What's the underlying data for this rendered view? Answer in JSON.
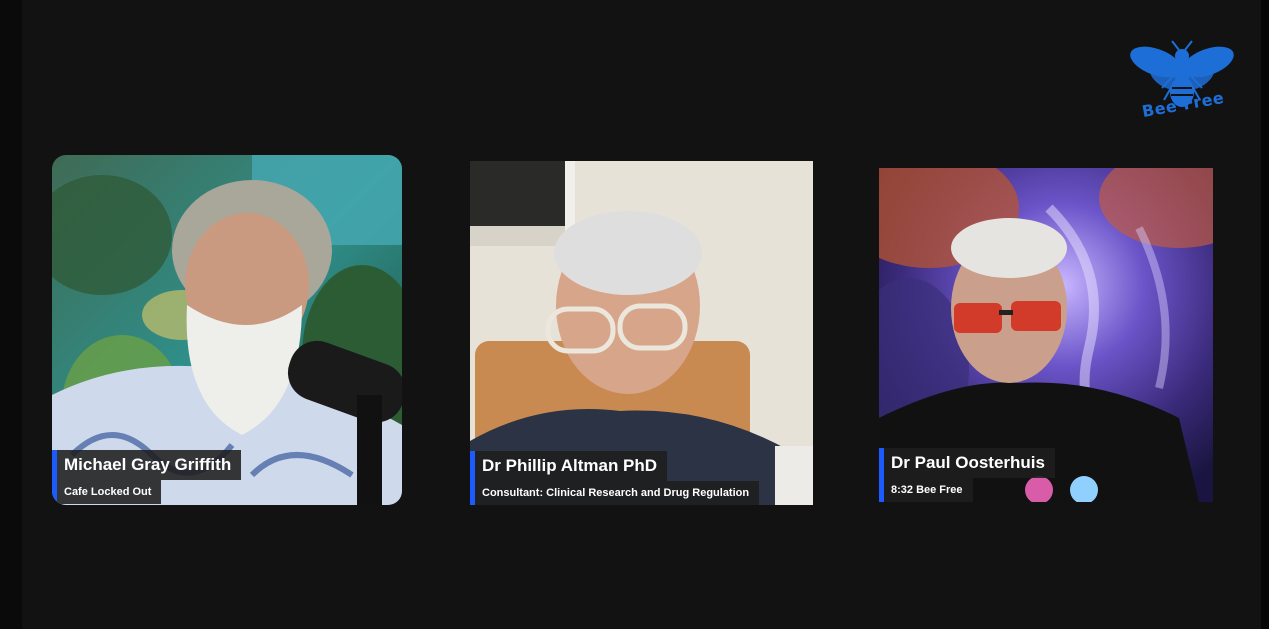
{
  "branding": {
    "logo_icon": "bee-icon",
    "logo_text": "Bee Free",
    "logo_color": "#1e6ed8"
  },
  "accent_color": "#1e5bff",
  "participants": [
    {
      "name": "Michael Gray Griffith",
      "subtitle": "Cafe Locked Out"
    },
    {
      "name": "Dr Phillip Altman PhD",
      "subtitle": "Consultant: Clinical Research and Drug Regulation"
    },
    {
      "name": "Dr Paul Oosterhuis",
      "subtitle": "8:32 Bee Free"
    }
  ]
}
